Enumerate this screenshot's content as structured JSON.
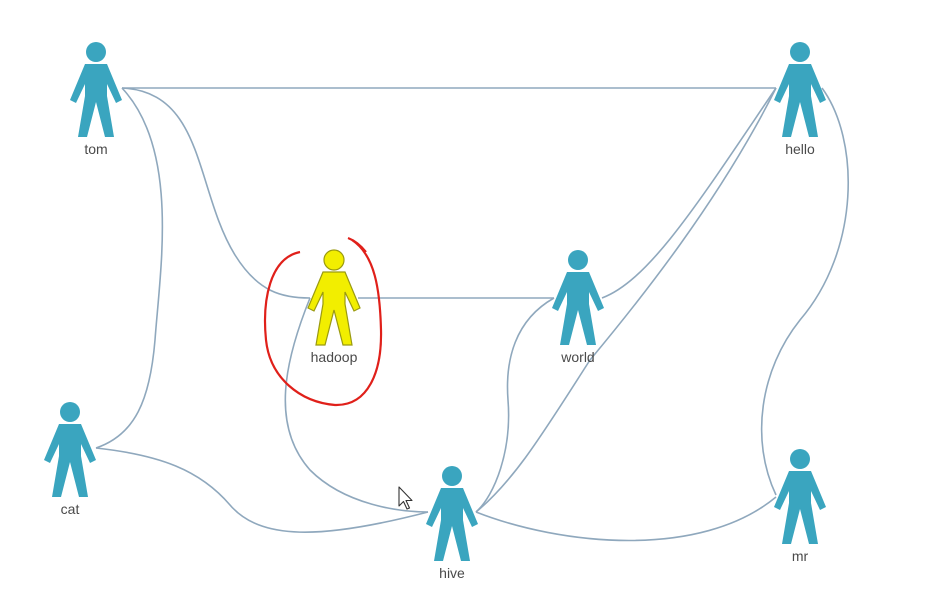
{
  "colors": {
    "person": "#3aa5bf",
    "selected": "#f2ee00",
    "selected_outline": "#9a9a10",
    "edge": "#8fa8bd",
    "highlight": "#e0201a"
  },
  "icons": {
    "node": "person-icon",
    "cursor": "mouse-pointer-icon"
  },
  "graph": {
    "selected": "hadoop",
    "nodes": [
      {
        "id": "tom",
        "label": "tom"
      },
      {
        "id": "hello",
        "label": "hello"
      },
      {
        "id": "hadoop",
        "label": "hadoop"
      },
      {
        "id": "world",
        "label": "world"
      },
      {
        "id": "cat",
        "label": "cat"
      },
      {
        "id": "hive",
        "label": "hive"
      },
      {
        "id": "mr",
        "label": "mr"
      }
    ],
    "edges": [
      {
        "from": "tom",
        "to": "hello"
      },
      {
        "from": "tom",
        "to": "hadoop"
      },
      {
        "from": "tom",
        "to": "cat"
      },
      {
        "from": "hadoop",
        "to": "world"
      },
      {
        "from": "hadoop",
        "to": "hive"
      },
      {
        "from": "world",
        "to": "hello"
      },
      {
        "from": "world",
        "to": "hive"
      },
      {
        "from": "hello",
        "to": "hive"
      },
      {
        "from": "hello",
        "to": "mr"
      },
      {
        "from": "cat",
        "to": "hive"
      },
      {
        "from": "hive",
        "to": "mr"
      }
    ]
  }
}
